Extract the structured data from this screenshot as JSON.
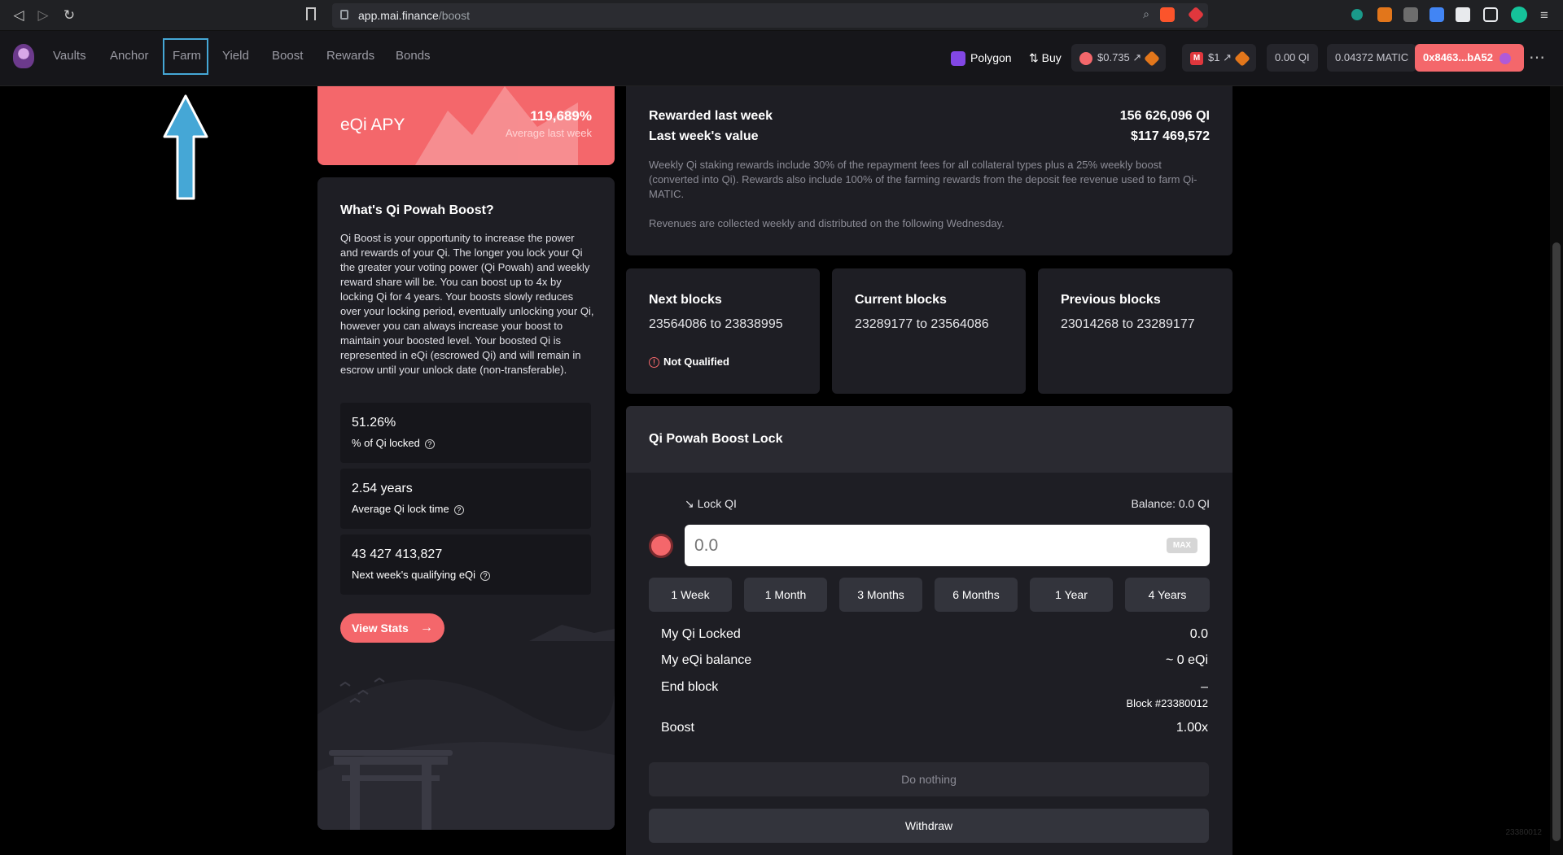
{
  "browser": {
    "url_host": "app.mai.finance",
    "url_path": "/boost"
  },
  "nav": {
    "items": [
      {
        "label": "Vaults"
      },
      {
        "label": "Anchor"
      },
      {
        "label": "Farm"
      },
      {
        "label": "Yield"
      },
      {
        "label": "Boost"
      },
      {
        "label": "Rewards"
      },
      {
        "label": "Bonds"
      }
    ],
    "network_label": "Polygon",
    "buy_label": "Buy",
    "qi_price": "$0.735",
    "mai_price": "$1",
    "qi_balance": "0.00 QI",
    "matic_balance": "0.04372 MATIC",
    "account": "0x8463...bA52"
  },
  "apy": {
    "title": "eQi APY",
    "value": "119,689%",
    "subtitle": "Average last week"
  },
  "about": {
    "title": "What's Qi Powah Boost?",
    "body": "Qi Boost is your opportunity to increase the power and rewards of your Qi. The longer you lock your Qi the greater your voting power (Qi Powah) and weekly reward share will be. You can boost up to 4x by locking Qi for 4 years. Your boosts slowly reduces over your locking period, eventually unlocking your Qi, however you can always increase your boost to maintain your boosted level. Your boosted Qi is represented in eQi (escrowed Qi) and will remain in escrow until your unlock date (non-transferable).",
    "stats": [
      {
        "value": "51.26%",
        "label": "% of Qi locked"
      },
      {
        "value": "2.54 years",
        "label": "Average Qi lock time"
      },
      {
        "value": "43 427 413,827",
        "label": "Next week's qualifying eQi"
      }
    ],
    "view_stats_label": "View Stats"
  },
  "rewards": {
    "rewarded_label": "Rewarded last week",
    "rewarded_value": "156 626,096 QI",
    "value_label": "Last week's value",
    "value_value": "$117 469,572",
    "note1": "Weekly Qi staking rewards include 30% of the repayment fees for all collateral types plus a 25% weekly boost (converted into Qi). Rewards also include 100% of the farming rewards from the deposit fee revenue used to farm Qi-MATIC.",
    "note2": "Revenues are collected weekly and distributed on the following Wednesday."
  },
  "blocks": {
    "next_title": "Next blocks",
    "next_range": "23564086 to 23838995",
    "next_status": "Not Qualified",
    "current_title": "Current blocks",
    "current_range": "23289177 to 23564086",
    "previous_title": "Previous blocks",
    "previous_range": "23014268 to 23289177"
  },
  "lock": {
    "title": "Qi Powah Boost Lock",
    "lock_label": "Lock QI",
    "balance": "Balance: 0.0 QI",
    "input_placeholder": "0.0",
    "max_label": "MAX",
    "durations": [
      "1 Week",
      "1 Month",
      "3 Months",
      "6 Months",
      "1 Year",
      "4 Years"
    ],
    "my_locked_label": "My Qi Locked",
    "my_locked_value": "0.0",
    "eqi_label": "My eQi balance",
    "eqi_value": "~ 0 eQi",
    "end_block_label": "End block",
    "end_block_value": "–",
    "end_block_sub": "Block #23380012",
    "boost_label": "Boost",
    "boost_value": "1.00x",
    "do_nothing_label": "Do nothing",
    "withdraw_label": "Withdraw"
  },
  "footer_block": "23380012",
  "colors": {
    "accent": "#f4676b",
    "card": "#1e1e24",
    "annotation": "#45a7d6"
  }
}
